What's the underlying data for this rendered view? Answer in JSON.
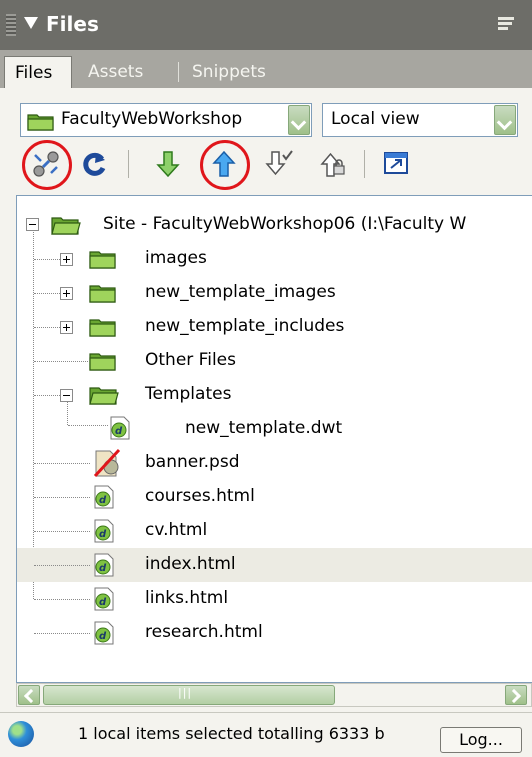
{
  "panel": {
    "title": "Files",
    "tabs": [
      "Files",
      "Assets",
      "Snippets"
    ],
    "active_tab": "Files"
  },
  "site_select": {
    "value": "FacultyWebWorkshop"
  },
  "view_select": {
    "value": "Local view"
  },
  "toolbar": {
    "buttons": [
      "connect-icon",
      "refresh-icon",
      "get-files-icon",
      "put-files-icon",
      "check-out-icon",
      "check-in-icon",
      "expand-icon"
    ]
  },
  "tree": {
    "root": "Site - FacultyWebWorkshop06 (I:\\Faculty W",
    "items": [
      {
        "label": "images",
        "type": "folder"
      },
      {
        "label": "new_template_images",
        "type": "folder"
      },
      {
        "label": "new_template_includes",
        "type": "folder"
      },
      {
        "label": "Other Files",
        "type": "folder"
      },
      {
        "label": "Templates",
        "type": "folder"
      },
      {
        "label": "new_template.dwt",
        "type": "file"
      },
      {
        "label": "banner.psd",
        "type": "file"
      },
      {
        "label": "courses.html",
        "type": "file"
      },
      {
        "label": "cv.html",
        "type": "file"
      },
      {
        "label": "index.html",
        "type": "file",
        "selected": true
      },
      {
        "label": "links.html",
        "type": "file"
      },
      {
        "label": "research.html",
        "type": "file"
      }
    ]
  },
  "status": {
    "text": "1 local items selected totalling 6333 b",
    "log_button": "Log..."
  },
  "colors": {
    "highlight_circle": "#e0161b",
    "folder_green": "#7fb83a",
    "selected_row": "#ecebe3"
  }
}
